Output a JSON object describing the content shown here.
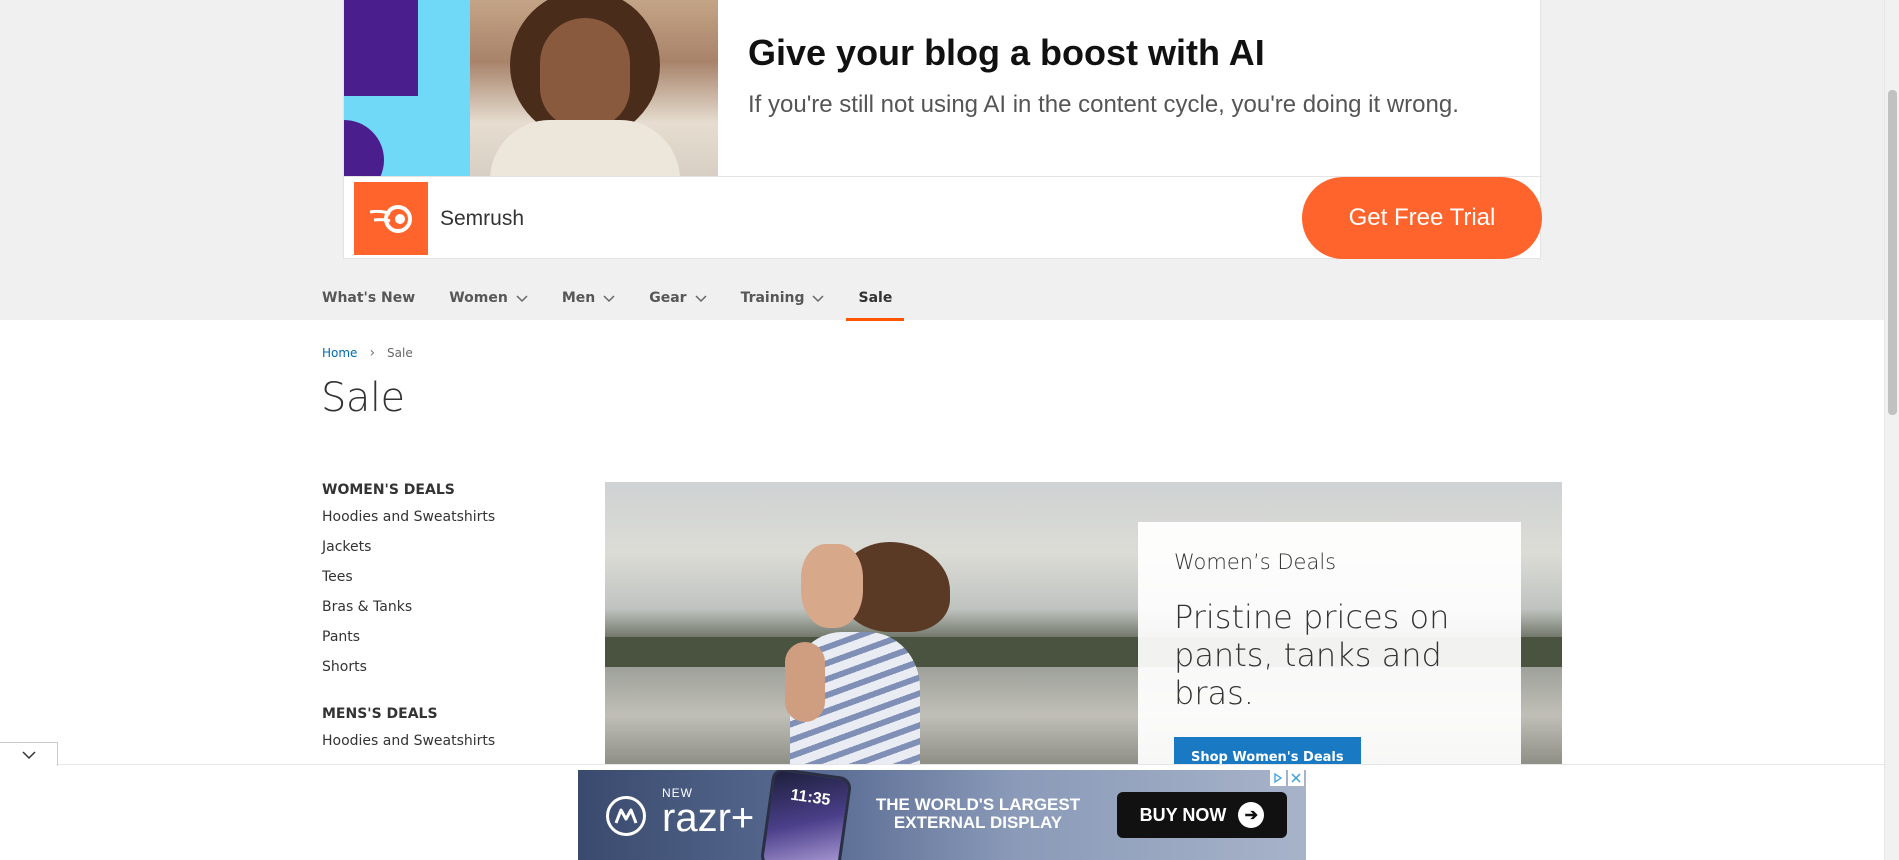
{
  "ad": {
    "title": "Give your blog a boost with AI",
    "subtitle": "If you're still not using AI in the content cycle, you're doing it wrong.",
    "brand": "Semrush",
    "cta": "Get Free Trial",
    "brand_color": "#ff642d"
  },
  "nav": {
    "items": [
      {
        "label": "What's New",
        "has_dropdown": false
      },
      {
        "label": "Women",
        "has_dropdown": true
      },
      {
        "label": "Men",
        "has_dropdown": true
      },
      {
        "label": "Gear",
        "has_dropdown": true
      },
      {
        "label": "Training",
        "has_dropdown": true
      },
      {
        "label": "Sale",
        "has_dropdown": false,
        "active": true
      }
    ],
    "active_color": "#ff5501"
  },
  "breadcrumb": {
    "home": "Home",
    "separator": "›",
    "current": "Sale"
  },
  "page": {
    "title": "Sale"
  },
  "sidebar": {
    "groups": [
      {
        "heading": "WOMEN'S DEALS",
        "links": [
          "Hoodies and Sweatshirts",
          "Jackets",
          "Tees",
          "Bras & Tanks",
          "Pants",
          "Shorts"
        ]
      },
      {
        "heading": "MENS'S DEALS",
        "links": [
          "Hoodies and Sweatshirts"
        ]
      }
    ]
  },
  "hero": {
    "kicker": "Women’s Deals",
    "headline": "Pristine prices on pants, tanks and bras.",
    "button": "Shop Women's Deals",
    "button_color": "#1979c3"
  },
  "anchor_ad": {
    "new_label": "NEW",
    "product": "razr+",
    "phone_time": "11:35",
    "tagline": "THE WORLD'S LARGEST EXTERNAL DISPLAY",
    "cta": "BUY NOW"
  }
}
